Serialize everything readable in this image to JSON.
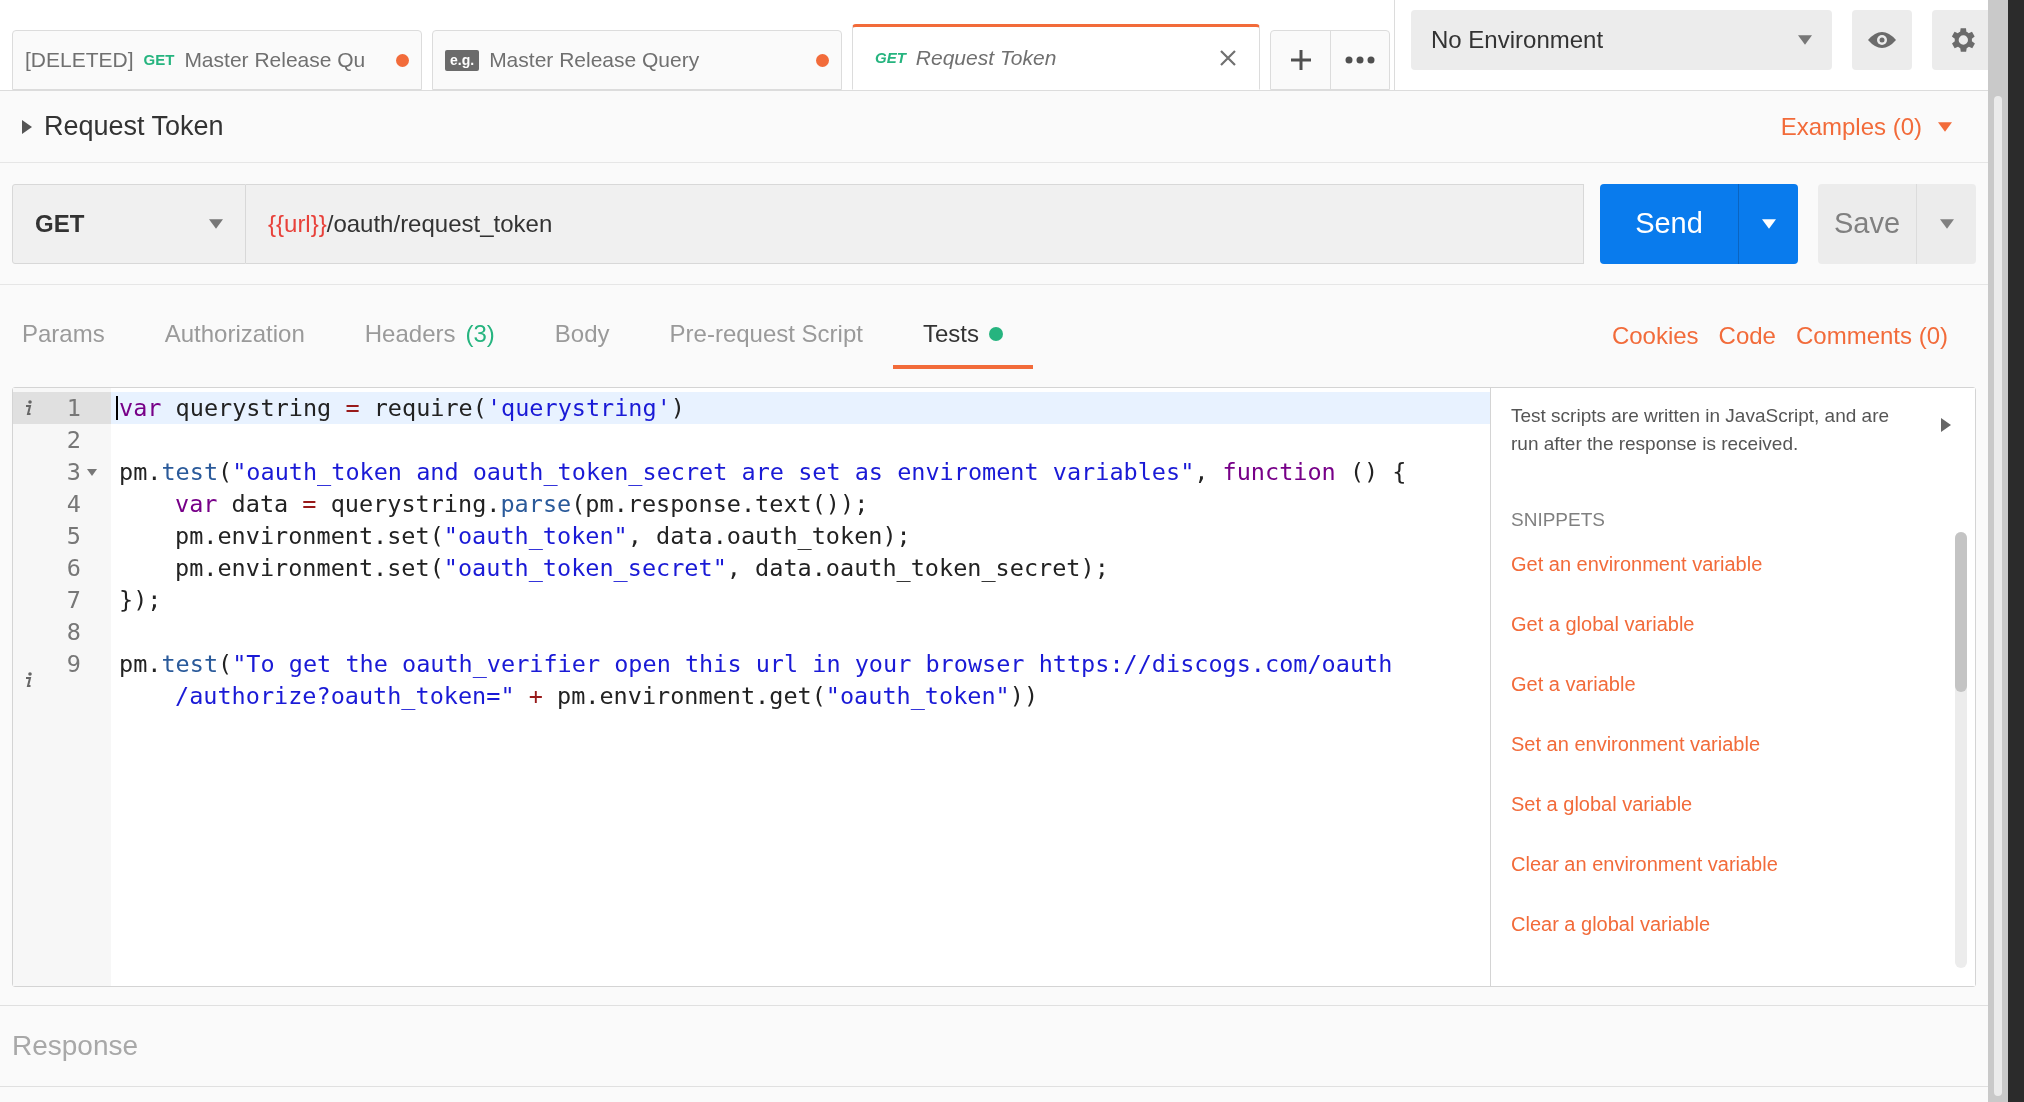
{
  "tabs": [
    {
      "prefix": "[DELETED]",
      "method": "GET",
      "title": "Master Release Qu",
      "preview": false,
      "unsaved": true,
      "selected": false
    },
    {
      "badge": "e.g.",
      "title": "Master Release Query",
      "preview": false,
      "unsaved": true,
      "selected": false
    },
    {
      "method": "GET",
      "title": "Request Token",
      "preview": true,
      "unsaved": false,
      "selected": true
    }
  ],
  "environment": {
    "value": "No Environment"
  },
  "request": {
    "name": "Request Token",
    "examples": "Examples (0)",
    "method": "GET",
    "url_variable": "{{url}}",
    "url_path": "/oauth/request_token",
    "send": "Send",
    "save": "Save"
  },
  "request_tabs": [
    {
      "label": "Params",
      "has_content": false,
      "selected": false
    },
    {
      "label": "Authorization",
      "has_content": false,
      "selected": false
    },
    {
      "label": "Headers",
      "count": "(3)",
      "has_content": false,
      "selected": false
    },
    {
      "label": "Body",
      "has_content": false,
      "selected": false
    },
    {
      "label": "Pre-request Script",
      "has_content": false,
      "selected": false
    },
    {
      "label": "Tests",
      "has_content": true,
      "selected": true
    }
  ],
  "request_links": [
    "Cookies",
    "Code",
    "Comments (0)"
  ],
  "editor": {
    "lines": [
      {
        "number": "1",
        "info": true,
        "foldable": false,
        "active": true,
        "tokens": [
          {
            "kind": "keyword",
            "text": "var"
          },
          {
            "kind": "text",
            "text": " querystring "
          },
          {
            "kind": "operator",
            "text": "="
          },
          {
            "kind": "text",
            "text": " require("
          },
          {
            "kind": "string",
            "text": "'querystring'"
          },
          {
            "kind": "text",
            "text": ")"
          }
        ]
      },
      {
        "number": "2",
        "info": false,
        "foldable": false,
        "active": false
      },
      {
        "number": "3",
        "info": false,
        "foldable": true,
        "active": false,
        "tokens": [
          {
            "kind": "text",
            "text": "pm."
          },
          {
            "kind": "property",
            "text": "test"
          },
          {
            "kind": "text",
            "text": "("
          },
          {
            "kind": "string",
            "text": "\"oauth_token and oauth_token_secret are set as enviroment variables\""
          },
          {
            "kind": "text",
            "text": ", "
          },
          {
            "kind": "keyword",
            "text": "function"
          },
          {
            "kind": "text",
            "text": " () {"
          }
        ]
      },
      {
        "number": "4",
        "info": false,
        "foldable": false,
        "active": false,
        "indented": true,
        "tokens": [
          {
            "kind": "keyword",
            "text": "var"
          },
          {
            "kind": "text",
            "text": " data "
          },
          {
            "kind": "operator",
            "text": "="
          },
          {
            "kind": "text",
            "text": " querystring."
          },
          {
            "kind": "property",
            "text": "parse"
          },
          {
            "kind": "text",
            "text": "(pm.response.text());"
          }
        ]
      },
      {
        "number": "5",
        "info": false,
        "foldable": false,
        "active": false,
        "indented": true,
        "tokens": [
          {
            "kind": "text",
            "text": "pm.environment.set("
          },
          {
            "kind": "string",
            "text": "\"oauth_token\""
          },
          {
            "kind": "text",
            "text": ", data.oauth_token);"
          }
        ]
      },
      {
        "number": "6",
        "info": false,
        "foldable": false,
        "active": false,
        "indented": true,
        "tokens": [
          {
            "kind": "text",
            "text": "pm.environment.set("
          },
          {
            "kind": "string",
            "text": "\"oauth_token_secret\""
          },
          {
            "kind": "text",
            "text": ", data.oauth_token_secret);"
          }
        ]
      },
      {
        "number": "7",
        "info": false,
        "foldable": false,
        "active": false,
        "tokens": [
          {
            "kind": "text",
            "text": "});"
          }
        ]
      },
      {
        "number": "8",
        "info": false,
        "foldable": false,
        "active": false
      },
      {
        "number": "9",
        "info": true,
        "foldable": false,
        "active": false,
        "tokens": [
          {
            "kind": "text",
            "text": "pm."
          },
          {
            "kind": "property",
            "text": "test"
          },
          {
            "kind": "text",
            "text": "("
          },
          {
            "kind": "string",
            "text": "\"To get the oauth_verifier open this url in your browser https://discogs.com/oauth"
          }
        ],
        "continuation": [
          {
            "kind": "string",
            "text": "/authorize?oauth_token=\""
          },
          {
            "kind": "operator",
            "text": " +"
          },
          {
            "kind": "text",
            "text": " pm.environment.get("
          },
          {
            "kind": "string",
            "text": "\"oauth_token\""
          },
          {
            "kind": "text",
            "text": "))"
          }
        ]
      }
    ]
  },
  "snippets_panel": {
    "description": "Test scripts are written in JavaScript, and are run after the response is received.",
    "heading": "SNIPPETS",
    "items": [
      "Get an environment variable",
      "Get a global variable",
      "Get a variable",
      "Set an environment variable",
      "Set a global variable",
      "Clear an environment variable",
      "Clear a global variable"
    ]
  },
  "response": {
    "title": "Response"
  }
}
